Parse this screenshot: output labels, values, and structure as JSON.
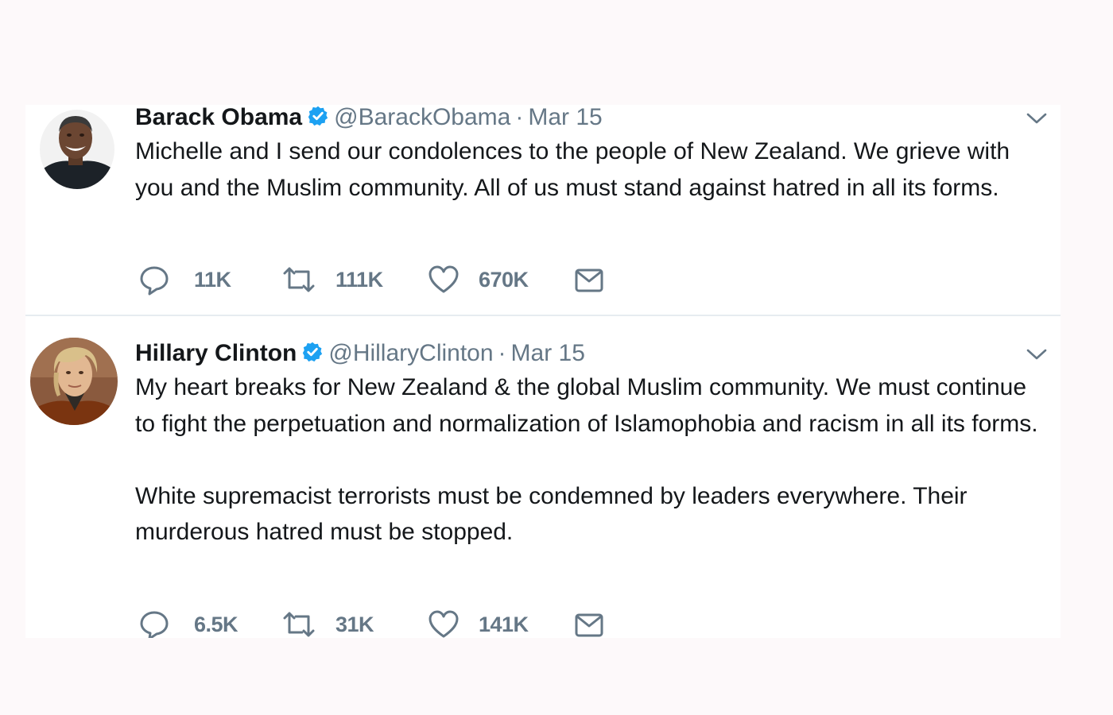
{
  "colors": {
    "background": "#fdf9fa",
    "card": "#ffffff",
    "verified_blue": "#1da1f2",
    "secondary_text": "#657786",
    "primary_text": "#14171a"
  },
  "tweets": [
    {
      "name": "Barack Obama",
      "handle": "@BarackObama",
      "separator": "·",
      "date": "Mar 15",
      "verified": true,
      "text": [
        "Michelle and I send our condolences to the people of New Zealand. We grieve with you and the Muslim community. All of us must stand against hatred in all its forms."
      ],
      "replies": "11K",
      "retweets": "111K",
      "likes": "670K",
      "icons": [
        "verified-badge-icon",
        "chevron-down-icon",
        "reply-icon",
        "retweet-icon",
        "like-icon",
        "direct-message-icon"
      ]
    },
    {
      "name": "Hillary Clinton",
      "handle": "@HillaryClinton",
      "separator": "·",
      "date": "Mar 15",
      "verified": true,
      "text": [
        "My heart breaks for New Zealand & the global Muslim community. We must continue to fight the perpetuation and normalization of Islamophobia and racism in all its forms.",
        "White supremacist terrorists must be condemned by leaders everywhere. Their murderous hatred must be stopped."
      ],
      "replies": "6.5K",
      "retweets": "31K",
      "likes": "141K",
      "icons": [
        "verified-badge-icon",
        "chevron-down-icon",
        "reply-icon",
        "retweet-icon",
        "like-icon",
        "direct-message-icon"
      ]
    }
  ]
}
